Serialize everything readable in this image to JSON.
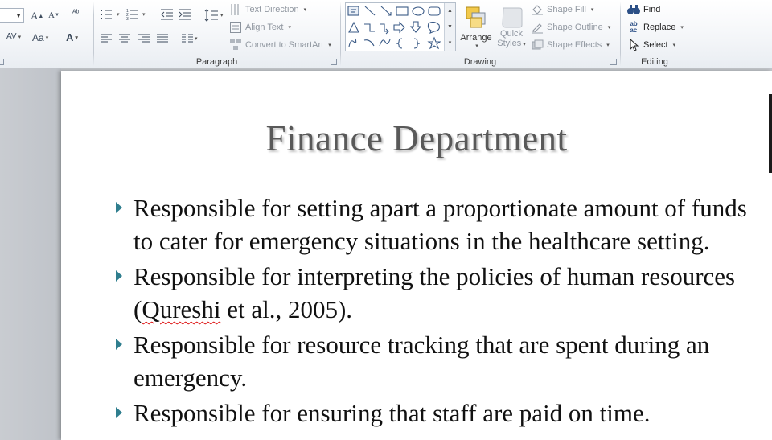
{
  "ribbon": {
    "paragraph": {
      "label": "Paragraph",
      "text_direction": "Text Direction",
      "align_text": "Align Text",
      "convert_smartart": "Convert to SmartArt"
    },
    "drawing": {
      "label": "Drawing",
      "arrange": "Arrange",
      "quick_styles_1": "Quick",
      "quick_styles_2": "Styles",
      "shape_fill": "Shape Fill",
      "shape_outline": "Shape Outline",
      "shape_effects": "Shape Effects"
    },
    "editing": {
      "label": "Editing",
      "find": "Find",
      "replace": "Replace",
      "select": "Select"
    }
  },
  "slide": {
    "title": "Finance Department",
    "bullets": [
      {
        "text": "Responsible for setting apart a proportionate amount of funds to cater for emergency situations in the healthcare setting."
      },
      {
        "before": "Responsible for interpreting the policies of human resources (",
        "misspelled": "Qureshi",
        "after": " et al., 2005)."
      },
      {
        "text": "Responsible for resource tracking that are spent during an emergency."
      },
      {
        "text": "Responsible for ensuring that staff are paid on time."
      }
    ]
  },
  "colors": {
    "bullet": "#2f7e8e",
    "title": "#595959",
    "ribbon_bg": "#f3f5f8"
  }
}
